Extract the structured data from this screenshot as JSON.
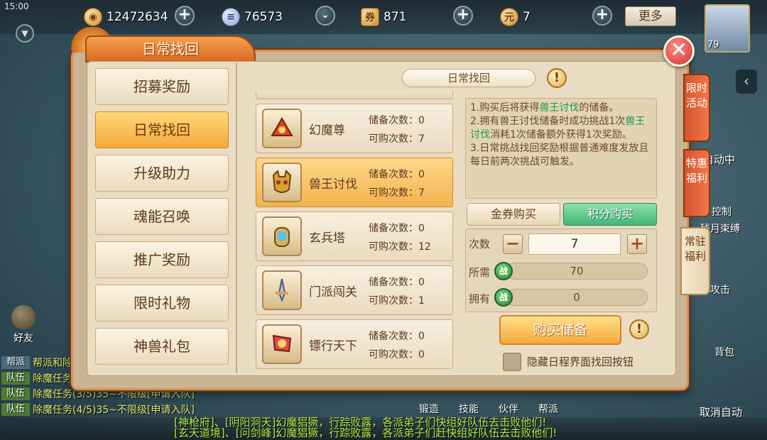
{
  "status_bar": {
    "time": "15:00"
  },
  "top_bar": {
    "copper": {
      "value": "12472634",
      "icon": "copper-coin-icon"
    },
    "scroll": {
      "value": "76573",
      "icon": "scroll-icon"
    },
    "ticket": {
      "value": "871",
      "icon": "ticket-icon"
    },
    "ingot": {
      "value": "7",
      "icon": "gold-ingot-icon"
    },
    "more_label": "更多",
    "avatar_level": "79"
  },
  "dialog": {
    "title": "日常找回",
    "close_label": "✕"
  },
  "menu": {
    "items": [
      {
        "label": "招募奖励",
        "active": false
      },
      {
        "label": "日常找回",
        "active": true
      },
      {
        "label": "升级助力",
        "active": false
      },
      {
        "label": "魂能召唤",
        "active": false
      },
      {
        "label": "推广奖励",
        "active": false
      },
      {
        "label": "限时礼物",
        "active": false
      },
      {
        "label": "神兽礼包",
        "active": false
      }
    ]
  },
  "list": {
    "header": "日常找回",
    "stock_label": "储备次数：",
    "buyable_label": "可购次数：",
    "rows": [
      {
        "name": "幻魔尊",
        "stock": "0",
        "buyable": "7",
        "icon": "scroll-fan-icon",
        "active": false
      },
      {
        "name": "兽王讨伐",
        "stock": "0",
        "buyable": "7",
        "icon": "beast-mask-icon",
        "active": true
      },
      {
        "name": "玄兵塔",
        "stock": "0",
        "buyable": "12",
        "icon": "tower-orb-icon",
        "active": false
      },
      {
        "name": "门派闯关",
        "stock": "0",
        "buyable": "1",
        "icon": "sword-shield-icon",
        "active": false
      },
      {
        "name": "镖行天下",
        "stock": "0",
        "buyable": "0",
        "icon": "escort-banner-icon",
        "active": false
      }
    ]
  },
  "panel": {
    "desc": {
      "l1a": "1.购买后将获得",
      "l1b": "兽王讨伐",
      "l1c": "的储备。",
      "l2a": "2.拥有兽王讨伐储备时成功挑战1次",
      "l2b": "兽王讨伐",
      "l2c": "消耗1次储备额外获得1次奖励。",
      "l3": "3.日常挑战找回奖励根据普通难度发放且每日前两次挑战可触发。"
    },
    "tab_gold": "金券购买",
    "tab_points": "积分购买",
    "qty_label": "次数",
    "qty_value": "7",
    "minus": "−",
    "plus": "+",
    "need_label": "所需",
    "need_value": "70",
    "have_label": "拥有",
    "have_value": "0",
    "coin_glyph": "战",
    "buy_label": "购买储备",
    "hide_label": "隐藏日程界面找回按钮"
  },
  "side_tabs": {
    "limited": "限时活动",
    "special": "特惠福利",
    "regular": "常驻福利"
  },
  "hud": {
    "auto_label": "自动中",
    "control_label": "控制",
    "skill_label": "残月束缚",
    "attack_label": "攻击",
    "backpack_label": "背包",
    "friend_label": "好友",
    "cancel_auto": "取消自动",
    "bottom": [
      "锻造",
      "技能",
      "伙伴",
      "帮派"
    ]
  },
  "chat": [
    {
      "tag": "帮派",
      "text": "帮派和除",
      "clan": true
    },
    {
      "tag": "队伍",
      "text": "除魔任务",
      "clan": false
    },
    {
      "tag": "队伍",
      "text": "除魔任务(3/5)35~不限级[申请入队]",
      "clan": false
    },
    {
      "tag": "队伍",
      "text": "除魔任务(4/5)35~不限级[申请入队]",
      "clan": false
    }
  ],
  "ticker": {
    "line1": "[神枪府]、[阴阳洞天]幻魔猖獗，行踪败露，各派弟子们快组好队伍去击败他们!",
    "line2": "[玄天道境]、[问剑峰]幻魔猖獗，行踪败露，各派弟子们赶快组好队伍去击败他们!"
  },
  "colors": {
    "accent_orange": "#f2a94a",
    "highlight_green": "#1a9a55",
    "points_tab_green": "#3fb777",
    "annotation_red": "#e12a2a"
  }
}
